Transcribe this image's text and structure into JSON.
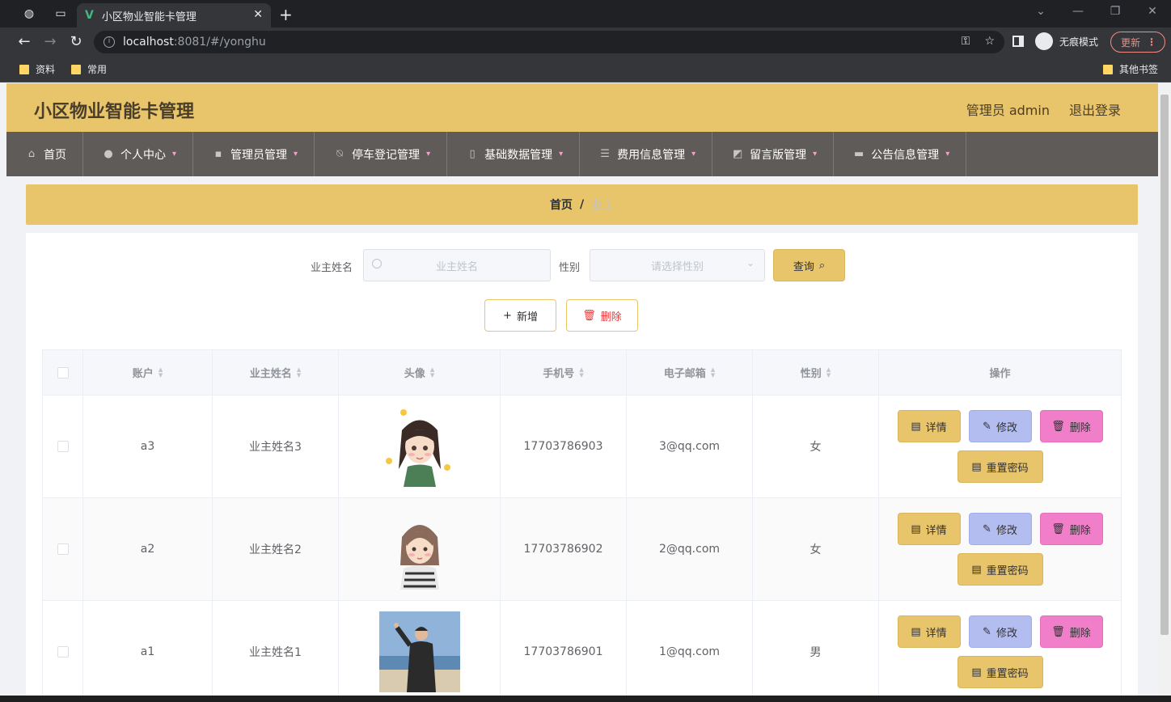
{
  "browser": {
    "tab_title": "小区物业智能卡管理",
    "url_host": "localhost",
    "url_path": ":8081/#/yonghu",
    "incognito_label": "无痕模式",
    "update_label": "更新",
    "bookmarks": [
      "资料",
      "常用"
    ],
    "other_bookmarks": "其他书签"
  },
  "header": {
    "title": "小区物业智能卡管理",
    "user": "管理员 admin",
    "logout": "退出登录"
  },
  "menu": [
    {
      "label": "首页",
      "icon": "home-icon"
    },
    {
      "label": "个人中心",
      "icon": "user-icon"
    },
    {
      "label": "管理员管理",
      "icon": "chat-icon"
    },
    {
      "label": "停车登记管理",
      "icon": "bell-off-icon"
    },
    {
      "label": "基础数据管理",
      "icon": "mic-icon"
    },
    {
      "label": "费用信息管理",
      "icon": "sliders-icon"
    },
    {
      "label": "留言版管理",
      "icon": "chart-icon"
    },
    {
      "label": "公告信息管理",
      "icon": "monitor-icon"
    }
  ],
  "breadcrumb": {
    "home": "首页",
    "current": "业主"
  },
  "search": {
    "name_label": "业主姓名",
    "name_placeholder": "业主姓名",
    "gender_label": "性别",
    "gender_placeholder": "请选择性别",
    "query_label": "查询"
  },
  "actions": {
    "add": "新增",
    "delete": "删除"
  },
  "table": {
    "columns": [
      "账户",
      "业主姓名",
      "头像",
      "手机号",
      "电子邮箱",
      "性别",
      "操作"
    ],
    "rows": [
      {
        "account": "a3",
        "name": "业主姓名3",
        "phone": "17703786903",
        "email": "3@qq.com",
        "gender": "女"
      },
      {
        "account": "a2",
        "name": "业主姓名2",
        "phone": "17703786902",
        "email": "2@qq.com",
        "gender": "女"
      },
      {
        "account": "a1",
        "name": "业主姓名1",
        "phone": "17703786901",
        "email": "1@qq.com",
        "gender": "男"
      }
    ],
    "ops": {
      "detail": "详情",
      "edit": "修改",
      "delete": "删除",
      "reset": "重置密码"
    }
  }
}
